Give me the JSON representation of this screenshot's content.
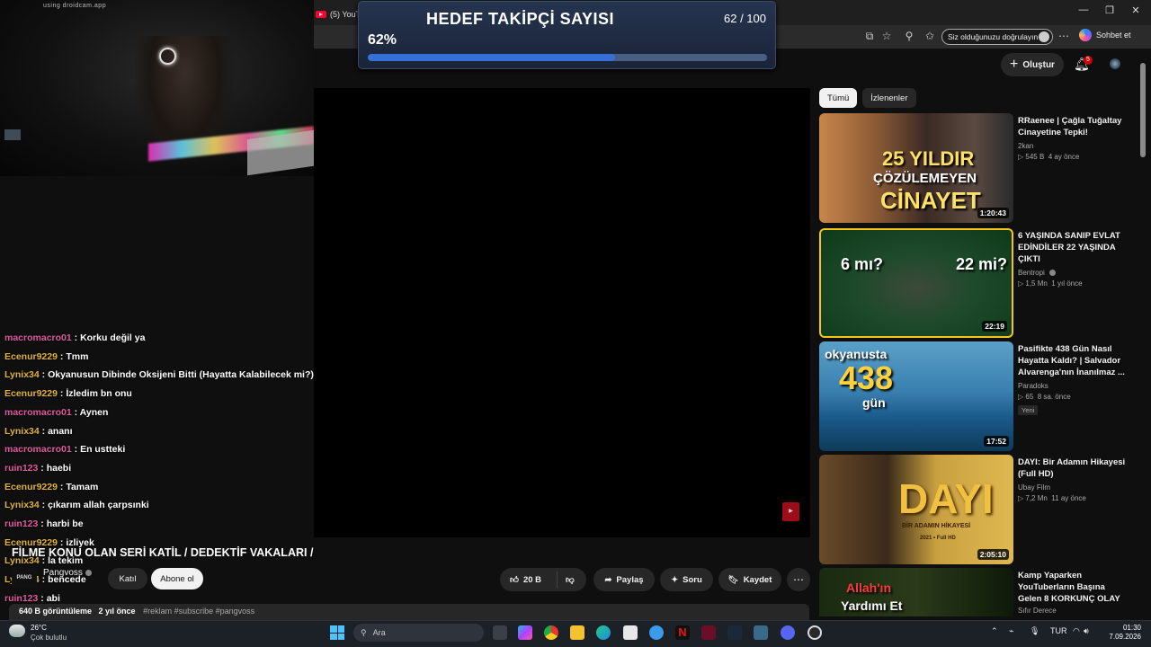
{
  "browser": {
    "tab_title": "(5) YouTu",
    "verify_label": "Siz olduğunuzu doğrulayın",
    "chat_label": "Sohbet et",
    "window_controls": [
      "—",
      "❐",
      "✕"
    ]
  },
  "webcam": {
    "label": "using droidcam.app"
  },
  "goal": {
    "title": "HEDEF TAKİPÇİ SAYISI",
    "count": "62 / 100",
    "percent": "62%",
    "progress_fraction": 0.62
  },
  "masthead": {
    "create_label": "Oluştur",
    "notification_count": "5"
  },
  "chat": [
    {
      "user": "macromacro01",
      "text": "Korku değil ya",
      "color": "#e05aa0"
    },
    {
      "user": "Ecenur9229",
      "text": "Tmm",
      "color": "#e0b43a"
    },
    {
      "user": "Lynix34",
      "text": "Okyanusun Dibinde Oksijeni Bitti (Hayatta Kalabilecek mi?)",
      "color": "#e0b43a"
    },
    {
      "user": "Ecenur9229",
      "text": "İzledim bn onu",
      "color": "#e0b43a"
    },
    {
      "user": "macromacro01",
      "text": "Aynen",
      "color": "#e05aa0"
    },
    {
      "user": "Lynix34",
      "text": "ananı",
      "color": "#e0b43a"
    },
    {
      "user": "macromacro01",
      "text": "En ustteki",
      "color": "#e05aa0"
    },
    {
      "user": "ruin123",
      "text": "haebi",
      "color": "#e05aa0"
    },
    {
      "user": "Ecenur9229",
      "text": "Tamam",
      "color": "#e0b43a"
    },
    {
      "user": "Lynix34",
      "text": "çıkarım allah çarpsınki",
      "color": "#e0b43a"
    },
    {
      "user": "ruin123",
      "text": "harbi be",
      "color": "#e05aa0"
    },
    {
      "user": "Ecenur9229",
      "text": "izliyek",
      "color": "#e0b43a"
    },
    {
      "user": "Lynix34",
      "text": "la tekim",
      "color": "#e0b43a"
    },
    {
      "user": "Lynix34",
      "text": "bencede",
      "color": "#e0b43a"
    },
    {
      "user": "ruin123",
      "text": "abi",
      "color": "#e05aa0"
    }
  ],
  "video": {
    "title": "FİLME KONU OLAN SERİ KATİL / DEDEKTİF VAKALARI /",
    "channel": "Pangvoss",
    "channel_avatar_text": "PANG",
    "join_label": "Katıl",
    "subscribe_label": "Abone ol",
    "likes": "20 B",
    "share_label": "Paylaş",
    "ask_label": "Soru",
    "save_label": "Kaydet",
    "views": "640 B görüntüleme",
    "age": "2 yıl önce",
    "tags": "#reklam #subscribe #pangvoss"
  },
  "chips": [
    {
      "label": "Tümü",
      "active": true
    },
    {
      "label": "İzlenenler",
      "active": false
    }
  ],
  "recommendations": [
    {
      "title": "RRaenee | Çağla Tuğaltay Cinayetine Tepki!",
      "channel": "2kan",
      "views": "545 B",
      "age": "4 ay önce",
      "duration": "1:20:43",
      "thumb_lines": [
        "25 YILDIR",
        "ÇÖZÜLEMEYEN",
        "CİNAYET"
      ]
    },
    {
      "title": "6 YAŞINDA SANIP EVLAT EDİNDİLER 22 YAŞINDA ÇIKTI",
      "channel": "Bentropi",
      "views": "1,5 Mn",
      "age": "1 yıl önce",
      "duration": "22:19",
      "thumb_lines": [
        "6 mı?",
        "22 mi?"
      ]
    },
    {
      "title": "Pasifikte 438 Gün Nasıl Hayatta Kaldı? | Salvador Alvarenga'nın İnanılmaz ...",
      "channel": "Paradoks",
      "views": "65",
      "age": "8 sa. önce",
      "badge": "Yeni",
      "duration": "17:52",
      "thumb_lines": [
        "okyanusta",
        "438",
        "gün"
      ]
    },
    {
      "title": "DAYI: Bir Adamın Hikayesi (Full HD)",
      "channel": "Ubay Film",
      "views": "7,2 Mn",
      "age": "11 ay önce",
      "duration": "2:05:10",
      "thumb_lines": [
        "DAYI",
        "BİR ADAMIN HİKAYESİ",
        "2021 • Full HD"
      ]
    },
    {
      "title": "Kamp Yaparken YouTuberların Başına Gelen 8 KORKUNÇ OLAY",
      "channel": "Sıfır Derece",
      "thumb_lines": [
        "Allah'ın",
        "Yardımı Et"
      ]
    }
  ],
  "taskbar": {
    "temperature": "26°C",
    "weather": "Çok bulutlu",
    "search_placeholder": "Ara",
    "language": "TUR",
    "time": "01:30",
    "date": "7.09.2026"
  }
}
